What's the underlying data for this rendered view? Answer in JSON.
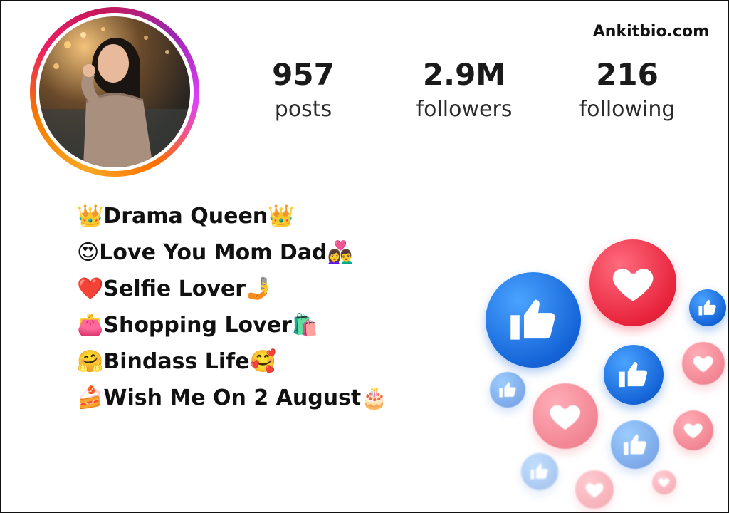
{
  "site_label": "Ankitbio.com",
  "profile": {
    "avatar_alt": "profile photo"
  },
  "stats": {
    "posts": {
      "value": "957",
      "label": "posts"
    },
    "followers": {
      "value": "2.9M",
      "label": "followers"
    },
    "following": {
      "value": "216",
      "label": "following"
    }
  },
  "bio": [
    {
      "pre": "👑",
      "text": "Drama Queen",
      "post": "👑"
    },
    {
      "pre": "😍",
      "text": "Love You Mom Dad",
      "post": "👩‍❤️‍👨"
    },
    {
      "pre": "❤️",
      "text": "Selfie Lover",
      "post": "🤳"
    },
    {
      "pre": "👛",
      "text": "Shopping Lover",
      "post": "🛍️"
    },
    {
      "pre": "🤗",
      "text": "Bindass Life",
      "post": "🥰"
    },
    {
      "pre": "🍰",
      "text": "Wish Me On 2 August",
      "post": "🎂"
    }
  ],
  "colors": {
    "like_blue": "#1565d8",
    "heart_red": "#e8243c",
    "ring_orange": "#f57c00",
    "ring_magenta": "#c2185b"
  },
  "decorations": [
    "like-icon",
    "heart-icon"
  ]
}
